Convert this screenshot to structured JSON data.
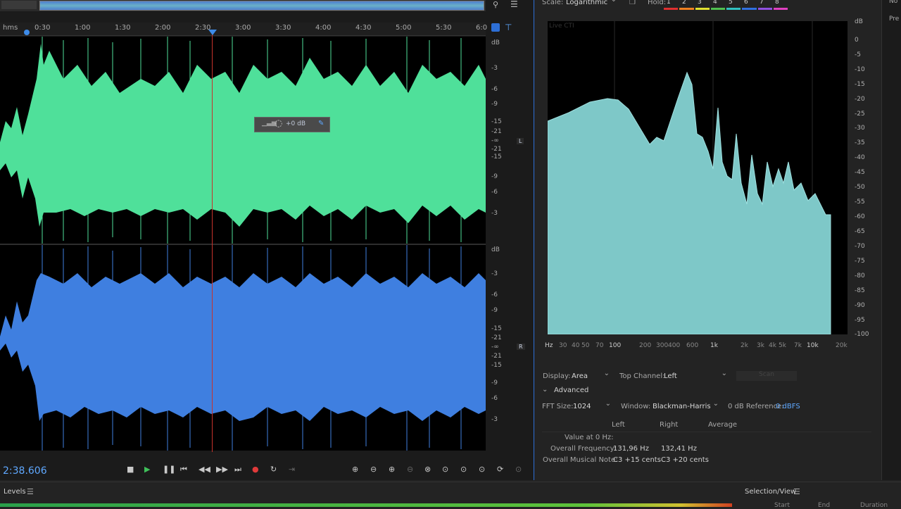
{
  "editor": {
    "ruler_label": "hms",
    "ruler_ticks": [
      "0:30",
      "1:00",
      "1:30",
      "2:00",
      "2:30",
      "3:00",
      "3:30",
      "4:00",
      "4:30",
      "5:00",
      "5:30",
      "6:0"
    ],
    "db_unit": "dB",
    "db_ticks_left": [
      "-3",
      "-6",
      "-9",
      "-15",
      "-21",
      "-∞",
      "-21",
      "-15",
      "-9",
      "-6",
      "-3"
    ],
    "db_ticks_right": [
      "-3",
      "-6",
      "-9",
      "-15",
      "-21",
      "-∞",
      "-21",
      "-15",
      "-9",
      "-6",
      "-3"
    ],
    "channel_left": "L",
    "channel_right": "R",
    "hud_gain": "+0 dB",
    "colors": {
      "left_wave": "#4fe09a",
      "right_wave": "#3f7fe0",
      "playhead": "#c7322c"
    }
  },
  "transport": {
    "timecode": "2:38.606",
    "icons": [
      "stop-icon",
      "play-icon",
      "pause-icon",
      "skip-back-icon",
      "rewind-icon",
      "fast-forward-icon",
      "skip-forward-icon",
      "record-icon",
      "loop-icon",
      "zoom-in-icon",
      "zoom-out-icon",
      "zoom-full-icon",
      "zoom-selection-icon"
    ]
  },
  "analysis": {
    "scale_label": "Scale:",
    "scale_value": "Logarithmic",
    "hold_label": "Hold:",
    "hold_slots": [
      "1",
      "2",
      "3",
      "4",
      "5",
      "6",
      "7",
      "8"
    ],
    "hold_colors": [
      "#e03030",
      "#f08020",
      "#e0e030",
      "#50c050",
      "#30c0c0",
      "#3070e0",
      "#9050e0",
      "#e040c0"
    ],
    "watermark": "Live CTI",
    "db_unit": "dB",
    "y_ticks": [
      "0",
      "-5",
      "-10",
      "-15",
      "-20",
      "-25",
      "-30",
      "-35",
      "-40",
      "-45",
      "-50",
      "-55",
      "-60",
      "-65",
      "-70",
      "-75",
      "-80",
      "-85",
      "-90",
      "-95",
      "-100"
    ],
    "x_ticks": [
      "Hz",
      "30",
      "40",
      "50",
      "70",
      "100",
      "200",
      "300",
      "400",
      "600",
      "1k",
      "2k",
      "3k",
      "4k",
      "5k",
      "7k",
      "10k",
      "20k"
    ],
    "display_label": "Display:",
    "display_value": "Area",
    "top_channel_label": "Top Channel:",
    "top_channel_value": "Left",
    "scan_label": "Scan",
    "advanced_label": "Advanced",
    "fft_label": "FFT Size:",
    "fft_value": "1024",
    "window_label": "Window:",
    "window_value": "Blackman-Harris",
    "ref_label": "0 dB Reference:",
    "ref_value": "0 dBFS",
    "col_left": "Left",
    "col_right": "Right",
    "col_average": "Average",
    "row_value0": "Value at 0 Hz:",
    "row_freq": "Overall Frequency:",
    "freq_left": "131,96 Hz",
    "freq_right": "132,41 Hz",
    "row_note": "Overall Musical Note:",
    "note_left": "C3 +15 cents",
    "note_right": "C3 +20 cents",
    "fill_color": "#7ec8c8"
  },
  "side": {
    "no_label": "No",
    "pre_label": "Pre"
  },
  "bottom": {
    "levels_label": "Levels",
    "selection_label": "Selection/View",
    "start_label": "Start",
    "end_label": "End",
    "duration_label": "Duration"
  }
}
